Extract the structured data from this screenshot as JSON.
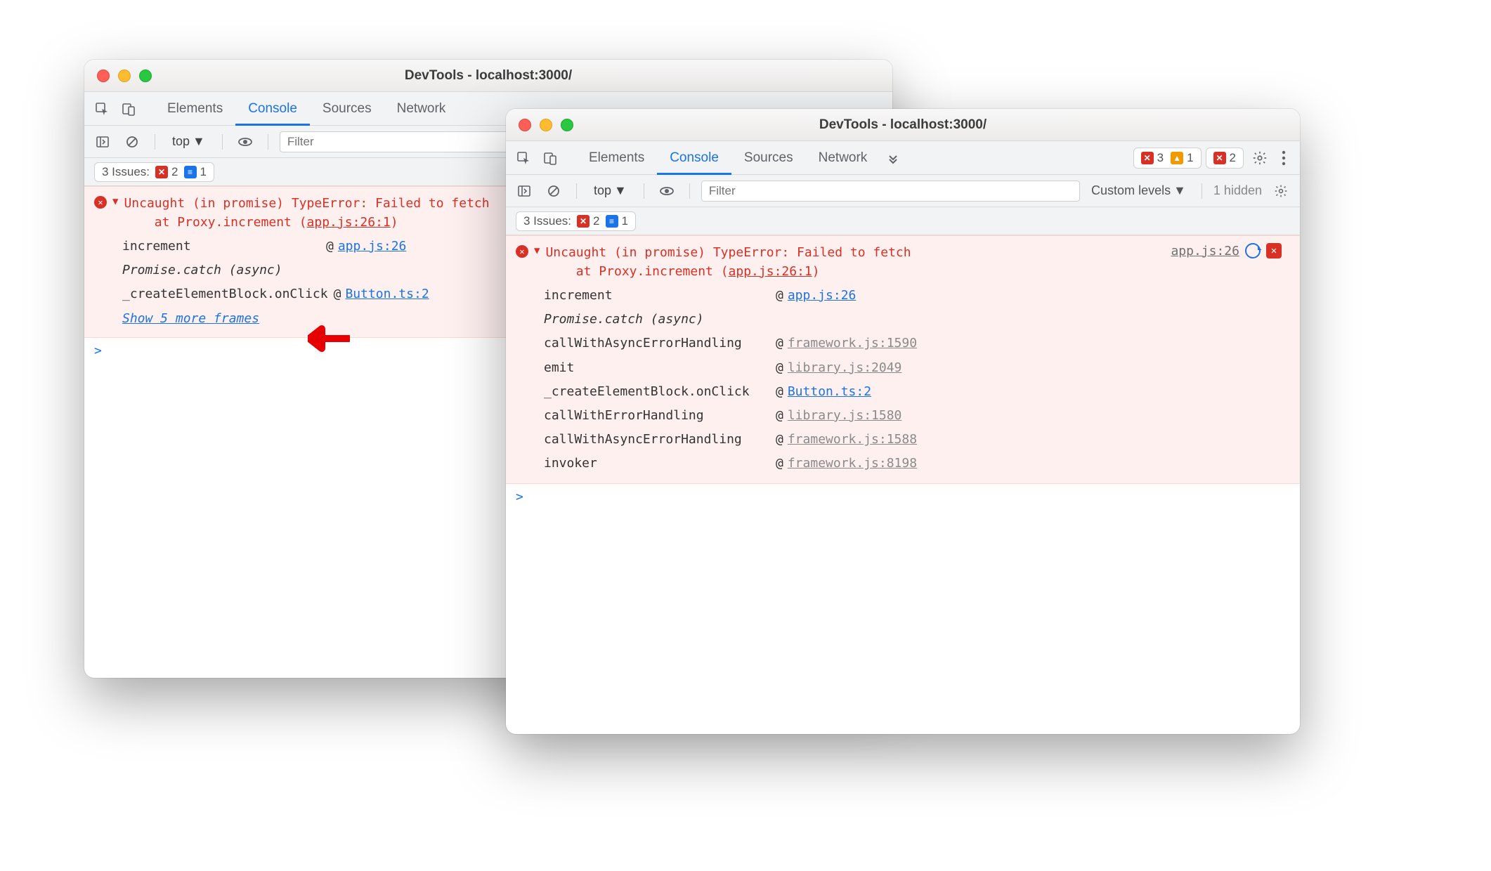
{
  "window_title": "DevTools - localhost:3000/",
  "tabs": {
    "elements": "Elements",
    "console": "Console",
    "sources": "Sources",
    "network": "Network"
  },
  "badges_left": {
    "errors": "2",
    "messages": "1"
  },
  "badges_right": {
    "errors": "3",
    "warnings": "1",
    "blocked": "2"
  },
  "subbar": {
    "context": "top",
    "filter_placeholder": "Filter",
    "levels": "Custom levels",
    "hidden": "1 hidden"
  },
  "issues": {
    "label": "3 Issues:",
    "errors": "2",
    "messages": "1"
  },
  "error": {
    "line1": "Uncaught (in promise) TypeError: Failed to fetch",
    "line2_prefix": "at Proxy.increment (",
    "line2_link": "app.js:26:1",
    "line2_suffix": ")",
    "source_link": "app.js:26"
  },
  "stack1": [
    {
      "fn": "increment",
      "at": "@",
      "link": "app.js:26",
      "muted": false,
      "italic": false
    },
    {
      "fn": "Promise.catch (async)",
      "italic": true
    },
    {
      "fn": "_createElementBlock.onClick",
      "at": "@",
      "link": "Button.ts:2",
      "muted": false,
      "italic": false
    }
  ],
  "show_more": "Show 5 more frames",
  "stack2": [
    {
      "fn": "increment",
      "at": "@",
      "link": "app.js:26",
      "muted": false,
      "italic": false
    },
    {
      "fn": "Promise.catch (async)",
      "italic": true
    },
    {
      "fn": "callWithAsyncErrorHandling",
      "at": "@",
      "link": "framework.js:1590",
      "muted": true,
      "italic": false
    },
    {
      "fn": "emit",
      "at": "@",
      "link": "library.js:2049",
      "muted": true,
      "italic": false
    },
    {
      "fn": "_createElementBlock.onClick",
      "at": "@",
      "link": "Button.ts:2",
      "muted": false,
      "italic": false
    },
    {
      "fn": "callWithErrorHandling",
      "at": "@",
      "link": "library.js:1580",
      "muted": true,
      "italic": false
    },
    {
      "fn": "callWithAsyncErrorHandling",
      "at": "@",
      "link": "framework.js:1588",
      "muted": true,
      "italic": false
    },
    {
      "fn": "invoker",
      "at": "@",
      "link": "framework.js:8198",
      "muted": true,
      "italic": false
    }
  ],
  "prompt": ">"
}
